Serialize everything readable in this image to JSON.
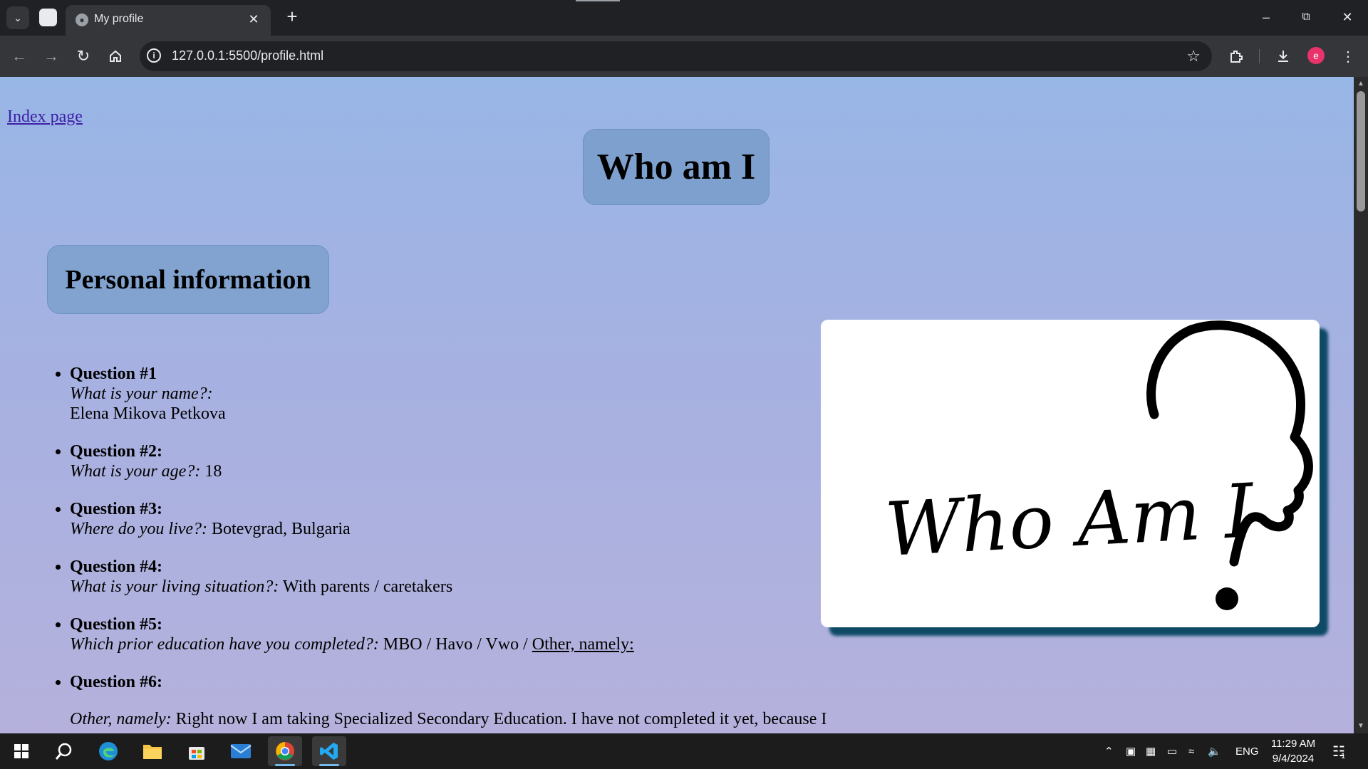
{
  "browser": {
    "tab_title": "My profile",
    "url": "127.0.0.1:5500/profile.html",
    "profile_initial": "e"
  },
  "page": {
    "index_link": "Index page",
    "title": "Who am I",
    "section_title": "Personal information",
    "picture_text": "Who Am I",
    "questions": [
      {
        "label": "Question #1",
        "question": "What is your name?:",
        "answer": "Elena Mikova Petkova"
      },
      {
        "label": "Question #2:",
        "question": "What is your age?:",
        "answer": "18"
      },
      {
        "label": "Question #3:",
        "question": "Where do you live?:",
        "answer": "Botevgrad, Bulgaria"
      },
      {
        "label": "Question #4:",
        "question": "What is your living situation?:",
        "answer": "With parents / caretakers"
      },
      {
        "label": "Question #5:",
        "question": "Which prior education have you completed?:",
        "answer": "MBO / Havo / Vwo /",
        "answer_underlined": "Other, namely:"
      },
      {
        "label": "Question #6:"
      }
    ],
    "other_line": {
      "question": "Other, namely:",
      "answer": "Right now I am taking Specialized Secondary Education. I have not completed it yet, because I"
    }
  },
  "taskbar": {
    "language": "ENG",
    "time": "11:29 AM",
    "date": "9/4/2024",
    "notification_count": "1"
  },
  "colors": {
    "page_gradient_top": "#98b6e6",
    "page_gradient_bottom": "#b5b1dc",
    "heading_box": "#7ea0cf",
    "picture_shadow": "#0e4a66",
    "link": "#3d1fa8"
  }
}
